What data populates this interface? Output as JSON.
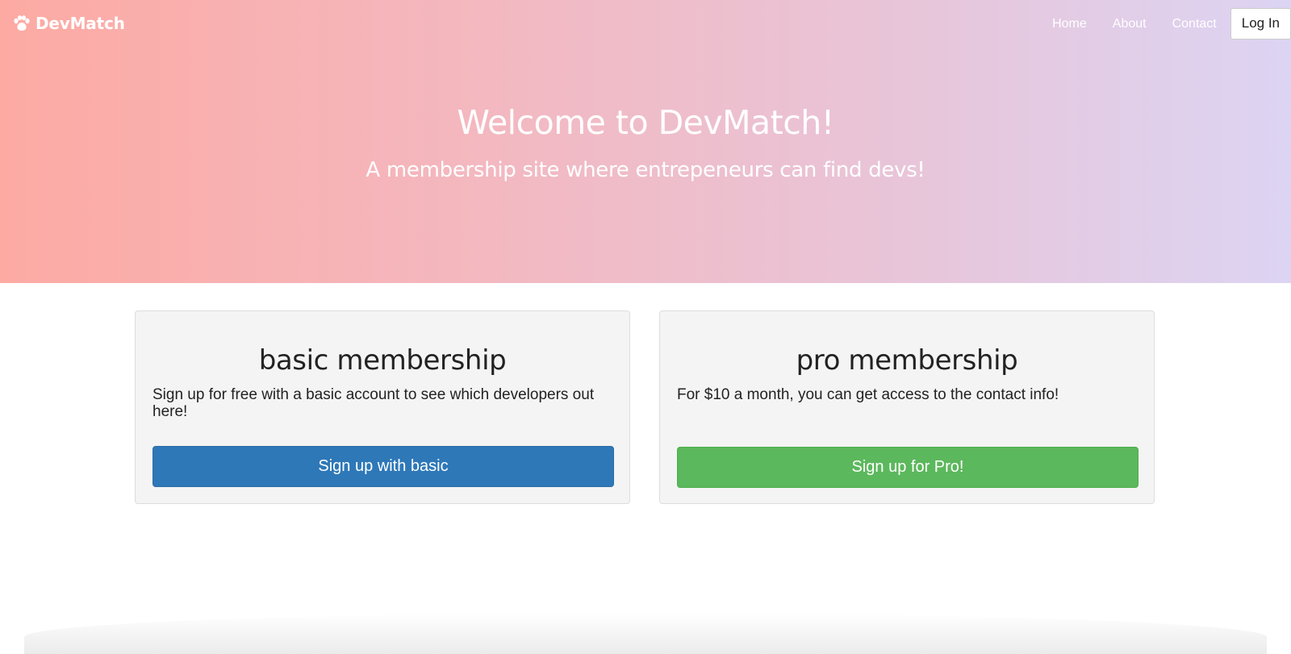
{
  "navbar": {
    "brand": "DevMatch",
    "brand_icon": "paw-icon",
    "links": [
      "Home",
      "About",
      "Contact"
    ],
    "login_label": "Log In"
  },
  "hero": {
    "title": "Welcome to DevMatch!",
    "subtitle": "A membership site where entrepeneurs can find devs!",
    "gradient_colors": [
      "#fdaaa3",
      "#dcd4f3"
    ]
  },
  "plans": {
    "basic": {
      "title": "basic membership",
      "description": "Sign up for free with a basic account to see which developers out here!",
      "button_label": "Sign up with basic",
      "button_color": "#2e78b8"
    },
    "pro": {
      "title": "pro membership",
      "description": "For $10 a month, you can get access to the contact info!",
      "button_label": "Sign up for Pro!",
      "button_color": "#5cb85c"
    }
  }
}
